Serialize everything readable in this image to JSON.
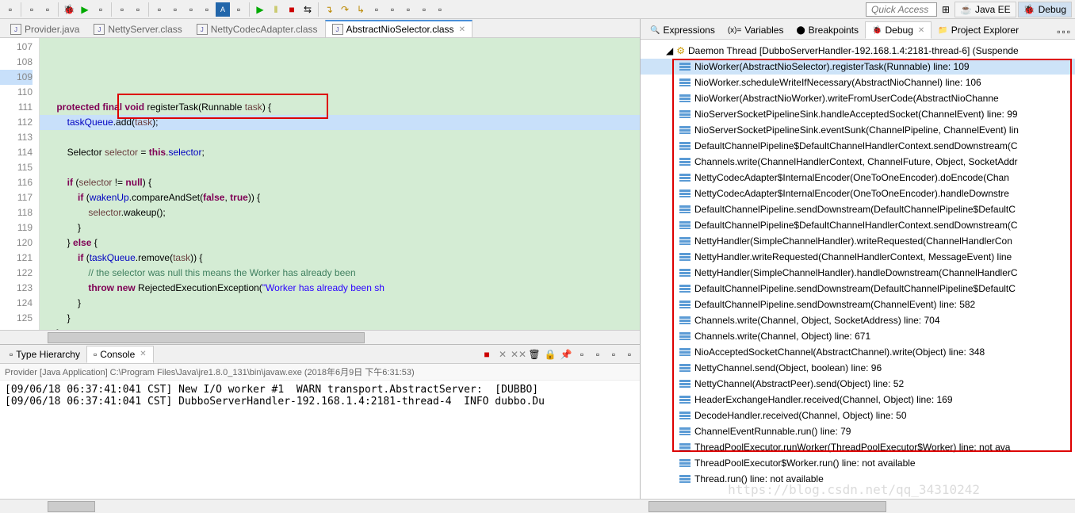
{
  "toolbar": {
    "quick_access_placeholder": "Quick Access",
    "perspectives": [
      {
        "label": "Java EE",
        "icon": "☕"
      },
      {
        "label": "Debug",
        "icon": "🐞"
      }
    ]
  },
  "editor": {
    "tabs": [
      {
        "label": "Provider.java",
        "active": false
      },
      {
        "label": "NettyServer.class",
        "active": false
      },
      {
        "label": "NettyCodecAdapter.class",
        "active": false
      },
      {
        "label": "AbstractNioSelector.class",
        "active": true
      }
    ],
    "first_line_no": 107,
    "code_lines": [
      {
        "raw": ""
      },
      {
        "raw": "    protected final void registerTask(Runnable task) {",
        "prefix": "    ",
        "segs": [
          [
            "kw",
            "protected"
          ],
          [
            "",
            " "
          ],
          [
            "kw",
            "final"
          ],
          [
            "",
            " "
          ],
          [
            "kw",
            "void"
          ],
          [
            "",
            " registerTask(Runnable "
          ],
          [
            "var",
            "task"
          ],
          [
            "",
            ") {"
          ]
        ]
      },
      {
        "raw": "        taskQueue.add(task);",
        "highlight": true,
        "prefix": "        ",
        "segs": [
          [
            "fld",
            "taskQueue"
          ],
          [
            "",
            ".add("
          ],
          [
            "var",
            "task"
          ],
          [
            "",
            ");"
          ]
        ]
      },
      {
        "raw": ""
      },
      {
        "raw": "        Selector selector = this.selector;",
        "prefix": "        ",
        "segs": [
          [
            "",
            "Selector "
          ],
          [
            "var",
            "selector"
          ],
          [
            "",
            " = "
          ],
          [
            "kw",
            "this"
          ],
          [
            "",
            "."
          ],
          [
            "fld",
            "selector"
          ],
          [
            "",
            ";"
          ]
        ]
      },
      {
        "raw": ""
      },
      {
        "raw": "        if (selector != null) {",
        "prefix": "        ",
        "segs": [
          [
            "kw",
            "if"
          ],
          [
            "",
            " ("
          ],
          [
            "var",
            "selector"
          ],
          [
            "",
            " != "
          ],
          [
            "kw",
            "null"
          ],
          [
            "",
            ") {"
          ]
        ]
      },
      {
        "raw": "            if (wakenUp.compareAndSet(false, true)) {",
        "prefix": "            ",
        "segs": [
          [
            "kw",
            "if"
          ],
          [
            "",
            " ("
          ],
          [
            "fld",
            "wakenUp"
          ],
          [
            "",
            ".compareAndSet("
          ],
          [
            "kw",
            "false"
          ],
          [
            "",
            ", "
          ],
          [
            "kw",
            "true"
          ],
          [
            "",
            ")) {"
          ]
        ]
      },
      {
        "raw": "                selector.wakeup();",
        "prefix": "                ",
        "segs": [
          [
            "var",
            "selector"
          ],
          [
            "",
            ".wakeup();"
          ]
        ]
      },
      {
        "raw": "            }",
        "prefix": "            ",
        "segs": [
          [
            "",
            "}"
          ]
        ]
      },
      {
        "raw": "        } else {",
        "prefix": "        ",
        "segs": [
          [
            "",
            "} "
          ],
          [
            "kw",
            "else"
          ],
          [
            "",
            " {"
          ]
        ]
      },
      {
        "raw": "            if (taskQueue.remove(task)) {",
        "prefix": "            ",
        "segs": [
          [
            "kw",
            "if"
          ],
          [
            "",
            " ("
          ],
          [
            "fld",
            "taskQueue"
          ],
          [
            "",
            ".remove("
          ],
          [
            "var",
            "task"
          ],
          [
            "",
            ")) {"
          ]
        ]
      },
      {
        "raw": "                // the selector was null this means the Worker has already been ",
        "prefix": "                ",
        "segs": [
          [
            "cmt",
            "// the selector was null this means the Worker has already been "
          ]
        ]
      },
      {
        "raw": "                throw new RejectedExecutionException(\"Worker has already been sh",
        "prefix": "                ",
        "segs": [
          [
            "kw",
            "throw"
          ],
          [
            "",
            " "
          ],
          [
            "kw",
            "new"
          ],
          [
            "",
            " RejectedExecutionException("
          ],
          [
            "str",
            "\"Worker has already been sh"
          ]
        ]
      },
      {
        "raw": "            }",
        "prefix": "            ",
        "segs": [
          [
            "",
            "}"
          ]
        ]
      },
      {
        "raw": "        }",
        "prefix": "        ",
        "segs": [
          [
            "",
            "}"
          ]
        ]
      },
      {
        "raw": "    }",
        "prefix": "    ",
        "segs": [
          [
            "",
            "}"
          ]
        ]
      },
      {
        "raw": ""
      },
      {
        "raw": "    protected final boolean isIoThread() {",
        "prefix": "    ",
        "segs": [
          [
            "kw",
            "protected"
          ],
          [
            "",
            " "
          ],
          [
            "kw",
            "final"
          ],
          [
            "",
            " "
          ],
          [
            "kw",
            "boolean"
          ],
          [
            "",
            " isIoThread() {"
          ]
        ]
      }
    ]
  },
  "console": {
    "tabs": [
      {
        "label": "Type Hierarchy",
        "active": false
      },
      {
        "label": "Console",
        "active": true
      }
    ],
    "info": "Provider [Java Application] C:\\Program Files\\Java\\jre1.8.0_131\\bin\\javaw.exe (2018年6月9日 下午6:31:53)",
    "lines": [
      "[09/06/18 06:37:41:041 CST] New I/O worker #1  WARN transport.AbstractServer:  [DUBBO] ",
      "[09/06/18 06:37:41:041 CST] DubboServerHandler-192.168.1.4:2181-thread-4  INFO dubbo.Du"
    ]
  },
  "rightPanel": {
    "tabs": [
      {
        "label": "Expressions",
        "icon": "🔍"
      },
      {
        "label": "Variables",
        "icon": "(x)="
      },
      {
        "label": "Breakpoints",
        "icon": "⬤"
      },
      {
        "label": "Debug",
        "icon": "🐞",
        "active": true
      },
      {
        "label": "Project Explorer",
        "icon": "📁"
      }
    ],
    "thread_label": "Daemon Thread [DubboServerHandler-192.168.1.4:2181-thread-6] (Suspende",
    "stack": [
      {
        "label": "NioWorker(AbstractNioSelector).registerTask(Runnable) line: 109",
        "selected": true
      },
      {
        "label": "NioWorker.scheduleWriteIfNecessary(AbstractNioChannel<?>) line: 106"
      },
      {
        "label": "NioWorker(AbstractNioWorker).writeFromUserCode(AbstractNioChanne"
      },
      {
        "label": "NioServerSocketPipelineSink.handleAcceptedSocket(ChannelEvent) line: 99"
      },
      {
        "label": "NioServerSocketPipelineSink.eventSunk(ChannelPipeline, ChannelEvent) lin"
      },
      {
        "label": "DefaultChannelPipeline$DefaultChannelHandlerContext.sendDownstream(C"
      },
      {
        "label": "Channels.write(ChannelHandlerContext, ChannelFuture, Object, SocketAddr"
      },
      {
        "label": "NettyCodecAdapter$InternalEncoder(OneToOneEncoder).doEncode(Chan"
      },
      {
        "label": "NettyCodecAdapter$InternalEncoder(OneToOneEncoder).handleDownstre"
      },
      {
        "label": "DefaultChannelPipeline.sendDownstream(DefaultChannelPipeline$DefaultC"
      },
      {
        "label": "DefaultChannelPipeline$DefaultChannelHandlerContext.sendDownstream(C"
      },
      {
        "label": "NettyHandler(SimpleChannelHandler).writeRequested(ChannelHandlerCon"
      },
      {
        "label": "NettyHandler.writeRequested(ChannelHandlerContext, MessageEvent) line"
      },
      {
        "label": "NettyHandler(SimpleChannelHandler).handleDownstream(ChannelHandlerC"
      },
      {
        "label": "DefaultChannelPipeline.sendDownstream(DefaultChannelPipeline$DefaultC"
      },
      {
        "label": "DefaultChannelPipeline.sendDownstream(ChannelEvent) line: 582"
      },
      {
        "label": "Channels.write(Channel, Object, SocketAddress) line: 704"
      },
      {
        "label": "Channels.write(Channel, Object) line: 671"
      },
      {
        "label": "NioAcceptedSocketChannel(AbstractChannel).write(Object) line: 348"
      },
      {
        "label": "NettyChannel.send(Object, boolean) line: 96"
      },
      {
        "label": "NettyChannel(AbstractPeer).send(Object) line: 52"
      },
      {
        "label": "HeaderExchangeHandler.received(Channel, Object) line: 169"
      },
      {
        "label": "DecodeHandler.received(Channel, Object) line: 50"
      },
      {
        "label": "ChannelEventRunnable.run() line: 79"
      }
    ],
    "stack_after": [
      {
        "label": "ThreadPoolExecutor.runWorker(ThreadPoolExecutor$Worker) line: not ava"
      },
      {
        "label": "ThreadPoolExecutor$Worker.run() line: not available"
      },
      {
        "label": "Thread.run() line: not available"
      }
    ]
  },
  "watermark": "https://blog.csdn.net/qq_34310242"
}
